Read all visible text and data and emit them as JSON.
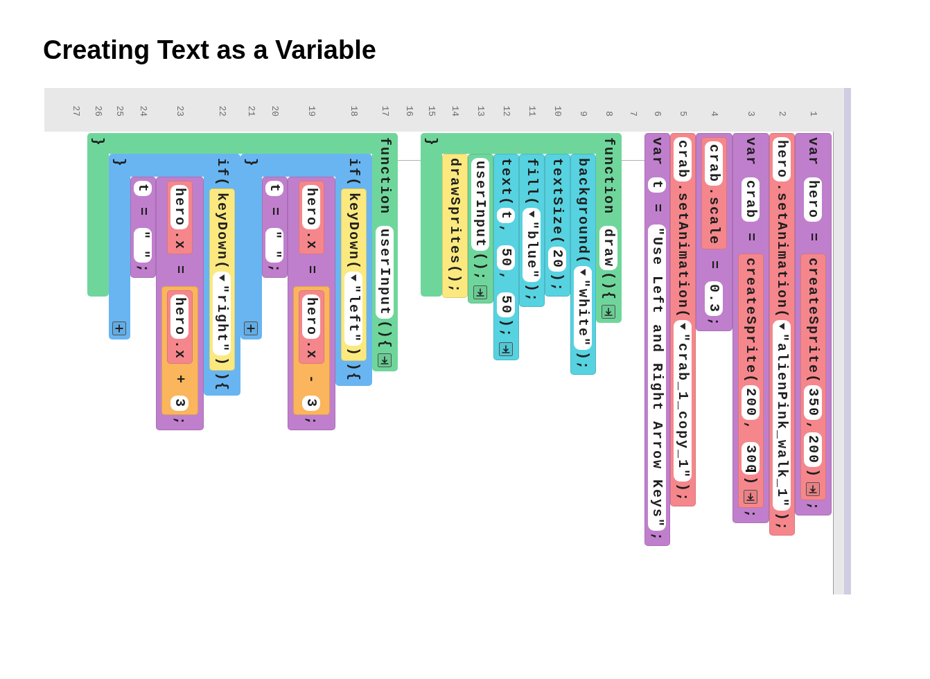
{
  "title": "Creating Text as a Variable",
  "editor": {
    "line_numbers": [
      "1",
      "2",
      "3",
      "4",
      "5",
      "6",
      "7",
      "8",
      "9",
      "10",
      "11",
      "12",
      "13",
      "14",
      "15",
      "16",
      "17",
      "18",
      "19",
      "20",
      "21",
      "22",
      "23",
      "24",
      "25",
      "26",
      "27"
    ],
    "blocks": [
      {
        "kind": "statement",
        "color": "#c07fcd",
        "parts": [
          {
            "kind": "text",
            "text": "var "
          },
          {
            "kind": "slot",
            "text": "hero"
          },
          {
            "kind": "text",
            "text": " = "
          },
          {
            "kind": "block",
            "color": "#f5878c",
            "parts": [
              {
                "kind": "text",
                "text": "createSprite("
              },
              {
                "kind": "slot",
                "text": "350"
              },
              {
                "kind": "text",
                "text": ","
              },
              {
                "kind": "slot",
                "text": "200"
              },
              {
                "kind": "text",
                "text": ")"
              },
              {
                "kind": "arrow"
              }
            ]
          },
          {
            "kind": "text",
            "text": ";"
          }
        ]
      },
      {
        "kind": "statement",
        "color": "#f5878c",
        "parts": [
          {
            "kind": "slot",
            "text": "hero"
          },
          {
            "kind": "text",
            "text": ".setAnimation("
          },
          {
            "kind": "menu",
            "text": "\"alienPink_walk_1\""
          },
          {
            "kind": "text",
            "text": ");"
          }
        ]
      },
      {
        "kind": "statement",
        "color": "#c07fcd",
        "parts": [
          {
            "kind": "text",
            "text": "var "
          },
          {
            "kind": "slot",
            "text": "crab"
          },
          {
            "kind": "text",
            "text": " = "
          },
          {
            "kind": "block",
            "color": "#f5878c",
            "parts": [
              {
                "kind": "text",
                "text": "createSprite("
              },
              {
                "kind": "slot",
                "text": "200"
              },
              {
                "kind": "text",
                "text": ", "
              },
              {
                "kind": "slot",
                "text": "300",
                "cursor": true
              },
              {
                "kind": "text",
                "text": ")"
              },
              {
                "kind": "arrow"
              }
            ]
          },
          {
            "kind": "text",
            "text": ";"
          }
        ]
      },
      {
        "kind": "statement",
        "color": "#c07fcd",
        "parts": [
          {
            "kind": "block",
            "color": "#f5878c",
            "parts": [
              {
                "kind": "slot",
                "text": "crab"
              },
              {
                "kind": "text",
                "text": ".scale"
              }
            ]
          },
          {
            "kind": "text",
            "text": " = "
          },
          {
            "kind": "slot",
            "text": "0.3"
          },
          {
            "kind": "text",
            "text": ";"
          }
        ]
      },
      {
        "kind": "statement",
        "color": "#f5878c",
        "parts": [
          {
            "kind": "slot",
            "text": "crab"
          },
          {
            "kind": "text",
            "text": ".setAnimation("
          },
          {
            "kind": "menu",
            "text": "\"crab_1_copy_1\""
          },
          {
            "kind": "text",
            "text": ");"
          }
        ]
      },
      {
        "kind": "statement",
        "color": "#c07fcd",
        "parts": [
          {
            "kind": "text",
            "text": "var "
          },
          {
            "kind": "slot",
            "text": "t"
          },
          {
            "kind": "text",
            "text": " = "
          },
          {
            "kind": "slot",
            "text": "\"Use Left and Right Arrow Keys\""
          },
          {
            "kind": "text",
            "text": ";"
          }
        ]
      },
      {
        "kind": "empty"
      },
      {
        "kind": "function",
        "color": "#6fd69b",
        "header": [
          {
            "kind": "text",
            "text": "function "
          },
          {
            "kind": "slot",
            "text": "draw"
          },
          {
            "kind": "text",
            "text": "(){"
          },
          {
            "kind": "arrow"
          }
        ],
        "children": [
          {
            "kind": "statement",
            "color": "#57d2e0",
            "parts": [
              {
                "kind": "text",
                "text": "background("
              },
              {
                "kind": "menu",
                "text": "\"white\""
              },
              {
                "kind": "text",
                "text": ");"
              }
            ]
          },
          {
            "kind": "statement",
            "color": "#57d2e0",
            "parts": [
              {
                "kind": "text",
                "text": "textSize("
              },
              {
                "kind": "slot",
                "text": "20"
              },
              {
                "kind": "text",
                "text": ");"
              }
            ]
          },
          {
            "kind": "statement",
            "color": "#57d2e0",
            "parts": [
              {
                "kind": "text",
                "text": "fill("
              },
              {
                "kind": "menu",
                "text": "\"blue\""
              },
              {
                "kind": "text",
                "text": ");"
              }
            ]
          },
          {
            "kind": "statement",
            "color": "#57d2e0",
            "parts": [
              {
                "kind": "text",
                "text": "text("
              },
              {
                "kind": "slot",
                "text": "t"
              },
              {
                "kind": "text",
                "text": ", "
              },
              {
                "kind": "slot",
                "text": "50"
              },
              {
                "kind": "text",
                "text": ", "
              },
              {
                "kind": "slot",
                "text": "50"
              },
              {
                "kind": "text",
                "text": ");"
              },
              {
                "kind": "arrow"
              }
            ]
          },
          {
            "kind": "statement",
            "color": "#6fd69b",
            "parts": [
              {
                "kind": "slot",
                "text": "userInput"
              },
              {
                "kind": "text",
                "text": "();"
              },
              {
                "kind": "arrow"
              }
            ]
          },
          {
            "kind": "statement",
            "color": "#fbe97f",
            "parts": [
              {
                "kind": "text",
                "text": "drawSprites();"
              }
            ]
          }
        ],
        "footer": [
          {
            "kind": "text",
            "text": "}"
          }
        ]
      },
      {
        "kind": "empty"
      },
      {
        "kind": "function",
        "color": "#6fd69b",
        "header": [
          {
            "kind": "text",
            "text": "function "
          },
          {
            "kind": "slot",
            "text": "userInput"
          },
          {
            "kind": "text",
            "text": "(){"
          },
          {
            "kind": "arrow"
          }
        ],
        "children": [
          {
            "kind": "if",
            "color": "#68b5f1",
            "header": [
              {
                "kind": "text",
                "text": "if("
              },
              {
                "kind": "block",
                "color": "#fbe97f",
                "parts": [
                  {
                    "kind": "text",
                    "text": "keyDown("
                  },
                  {
                    "kind": "menu",
                    "text": "\"left\""
                  },
                  {
                    "kind": "text",
                    "text": ")"
                  }
                ]
              },
              {
                "kind": "text",
                "text": "){"
              }
            ],
            "children": [
              {
                "kind": "statement",
                "color": "#c07fcd",
                "parts": [
                  {
                    "kind": "block",
                    "color": "#f5878c",
                    "parts": [
                      {
                        "kind": "slot",
                        "text": "hero"
                      },
                      {
                        "kind": "text",
                        "text": ".x"
                      }
                    ]
                  },
                  {
                    "kind": "text",
                    "text": " = "
                  },
                  {
                    "kind": "block",
                    "color": "#fbb55c",
                    "parts": [
                      {
                        "kind": "block",
                        "color": "#f5878c",
                        "parts": [
                          {
                            "kind": "slot",
                            "text": "hero"
                          },
                          {
                            "kind": "text",
                            "text": ".x"
                          }
                        ]
                      },
                      {
                        "kind": "text",
                        "text": " - "
                      },
                      {
                        "kind": "slot",
                        "text": "3"
                      }
                    ]
                  },
                  {
                    "kind": "text",
                    "text": ";"
                  }
                ]
              },
              {
                "kind": "statement",
                "color": "#c07fcd",
                "parts": [
                  {
                    "kind": "slot",
                    "text": "t"
                  },
                  {
                    "kind": "text",
                    "text": " = "
                  },
                  {
                    "kind": "slot",
                    "text": "\" \""
                  },
                  {
                    "kind": "text",
                    "text": ";"
                  }
                ]
              }
            ],
            "footer": [
              {
                "kind": "text",
                "text": "}"
              },
              {
                "kind": "add"
              }
            ]
          },
          {
            "kind": "if",
            "color": "#68b5f1",
            "header": [
              {
                "kind": "text",
                "text": "if("
              },
              {
                "kind": "block",
                "color": "#fbe97f",
                "parts": [
                  {
                    "kind": "text",
                    "text": "keyDown("
                  },
                  {
                    "kind": "menu",
                    "text": "\"right\""
                  },
                  {
                    "kind": "text",
                    "text": ")"
                  }
                ]
              },
              {
                "kind": "text",
                "text": "){"
              }
            ],
            "children": [
              {
                "kind": "statement",
                "color": "#c07fcd",
                "parts": [
                  {
                    "kind": "block",
                    "color": "#f5878c",
                    "parts": [
                      {
                        "kind": "slot",
                        "text": "hero"
                      },
                      {
                        "kind": "text",
                        "text": ".x"
                      }
                    ]
                  },
                  {
                    "kind": "text",
                    "text": " = "
                  },
                  {
                    "kind": "block",
                    "color": "#fbb55c",
                    "parts": [
                      {
                        "kind": "block",
                        "color": "#f5878c",
                        "parts": [
                          {
                            "kind": "slot",
                            "text": "hero"
                          },
                          {
                            "kind": "text",
                            "text": ".x"
                          }
                        ]
                      },
                      {
                        "kind": "text",
                        "text": " + "
                      },
                      {
                        "kind": "slot",
                        "text": "3"
                      }
                    ]
                  },
                  {
                    "kind": "text",
                    "text": ";"
                  }
                ]
              },
              {
                "kind": "statement",
                "color": "#c07fcd",
                "parts": [
                  {
                    "kind": "slot",
                    "text": "t"
                  },
                  {
                    "kind": "text",
                    "text": " = "
                  },
                  {
                    "kind": "slot",
                    "text": "\" \""
                  },
                  {
                    "kind": "text",
                    "text": ";"
                  }
                ]
              }
            ],
            "footer": [
              {
                "kind": "text",
                "text": "}"
              },
              {
                "kind": "add"
              }
            ]
          }
        ],
        "footer": [
          {
            "kind": "text",
            "text": "}"
          }
        ]
      },
      {
        "kind": "empty"
      }
    ]
  }
}
